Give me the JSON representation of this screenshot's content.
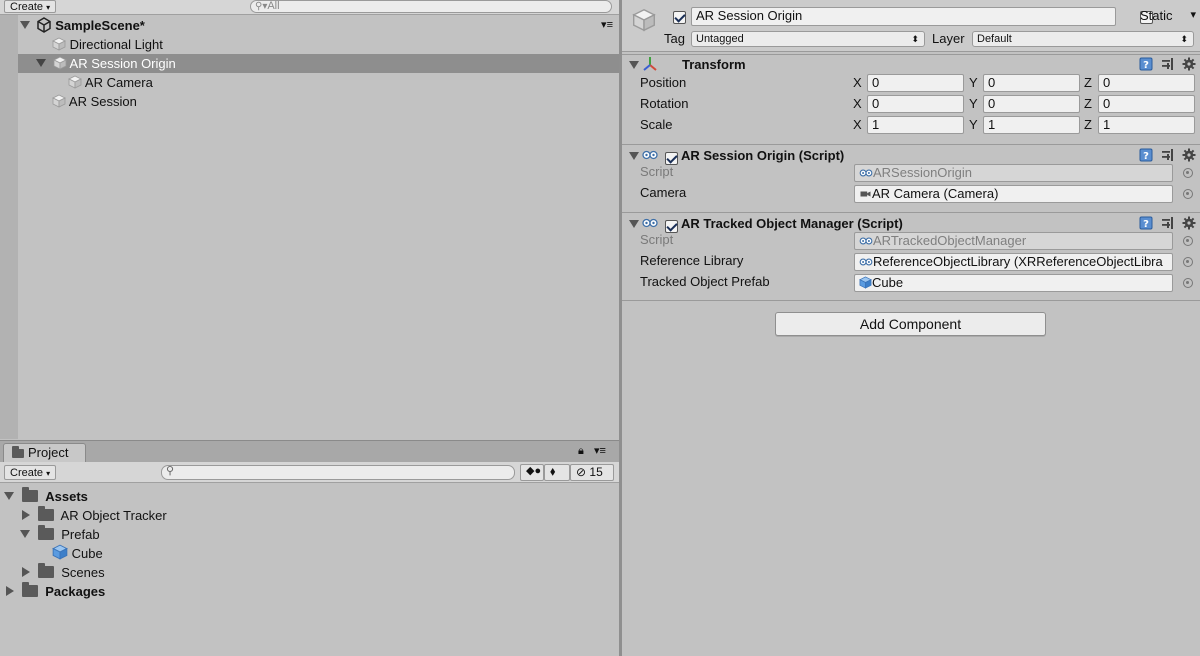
{
  "hierarchy": {
    "create_label": "Create",
    "search_placeholder": "All",
    "scene_name": "SampleScene*",
    "items": [
      {
        "label": "Directional Light"
      },
      {
        "label": "AR Session Origin"
      },
      {
        "label": "AR Camera"
      },
      {
        "label": "AR Session"
      }
    ]
  },
  "project": {
    "tab_label": "Project",
    "create_label": "Create",
    "hidden_count": "15",
    "tree": [
      {
        "label": "Assets"
      },
      {
        "label": "AR Object Tracker"
      },
      {
        "label": "Prefab"
      },
      {
        "label": "Cube"
      },
      {
        "label": "Scenes"
      },
      {
        "label": "Packages"
      }
    ]
  },
  "inspector": {
    "object_name": "AR Session Origin",
    "static_label": "Static",
    "tag_label": "Tag",
    "tag_value": "Untagged",
    "layer_label": "Layer",
    "layer_value": "Default",
    "transform": {
      "title": "Transform",
      "rows": [
        {
          "label": "Position",
          "x": "0",
          "y": "0",
          "z": "0"
        },
        {
          "label": "Rotation",
          "x": "0",
          "y": "0",
          "z": "0"
        },
        {
          "label": "Scale",
          "x": "1",
          "y": "1",
          "z": "1"
        }
      ],
      "axes": [
        "X",
        "Y",
        "Z"
      ]
    },
    "session_origin": {
      "title": "AR Session Origin (Script)",
      "script_label": "Script",
      "script_value": "ARSessionOrigin",
      "camera_label": "Camera",
      "camera_value": "AR Camera (Camera)"
    },
    "tracked_manager": {
      "title": "AR Tracked Object Manager (Script)",
      "script_label": "Script",
      "script_value": "ARTrackedObjectManager",
      "library_label": "Reference Library",
      "library_value": "ReferenceObjectLibrary (XRReferenceObjectLibra",
      "prefab_label": "Tracked Object Prefab",
      "prefab_value": "Cube"
    },
    "add_component_label": "Add Component"
  },
  "colors": {
    "panel_bg": "#c2c2c2",
    "selection": "#8e8e8e",
    "cube_blue": "#4f8fd6"
  }
}
